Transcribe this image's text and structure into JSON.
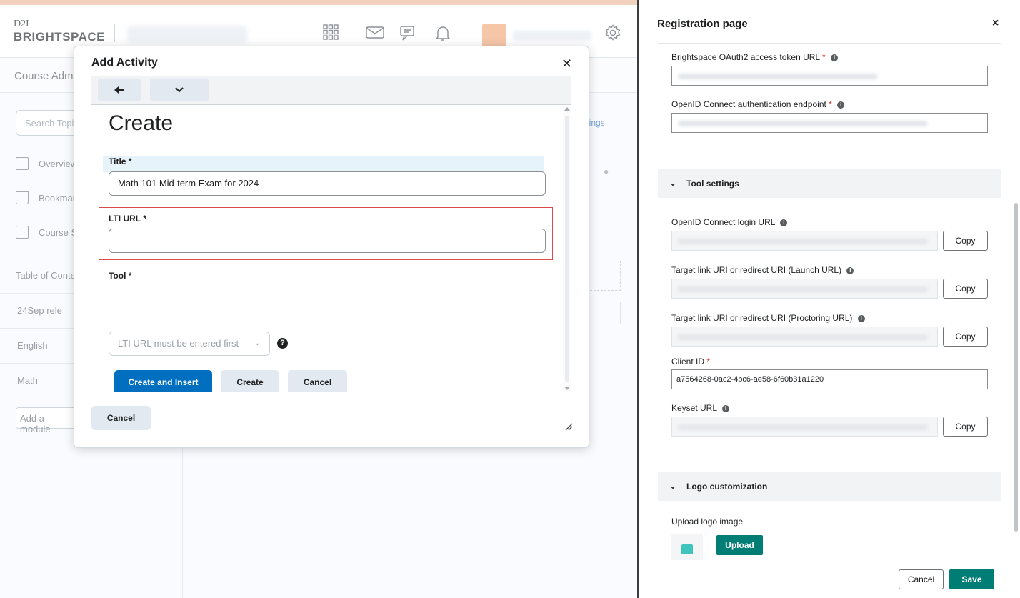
{
  "brightspace": {
    "logo_top": "D2L",
    "logo_bottom": "BRIGHTSPACE",
    "subnav_label": "Course Adm",
    "search_placeholder": "Search Topi",
    "sidebar_items": [
      {
        "label": "Overview",
        "icon": "presentation-icon"
      },
      {
        "label": "Bookmar",
        "icon": "bookmark-icon"
      },
      {
        "label": "Course S",
        "icon": "calendar-icon"
      }
    ],
    "toc_label": "Table of Conte",
    "modules": [
      "24Sep rele",
      "English",
      "Math"
    ],
    "add_module": "Add a module",
    "settings_link": "ttings"
  },
  "dialog": {
    "title": "Add Activity",
    "close_symbol": "✕",
    "back_symbol": "🡐",
    "menu_symbol": "⌄",
    "heading": "Create",
    "title_label": "Title *",
    "title_value": "Math 101 Mid-term Exam for 2024",
    "lti_url_label": "LTI URL *",
    "lti_url_value": "",
    "tool_label": "Tool *",
    "tool_select_value": "LTI URL must be entered first",
    "help_symbol": "?",
    "buttons": {
      "create_insert": "Create and Insert",
      "create": "Create",
      "cancel": "Cancel"
    },
    "footer_cancel": "Cancel"
  },
  "panel": {
    "title": "Registration page",
    "close_symbol": "×",
    "fields_top": [
      {
        "label": "Brightspace OAuth2 access token URL",
        "required": "*"
      },
      {
        "label": "OpenID Connect authentication endpoint",
        "required": "*"
      }
    ],
    "tool_settings": {
      "section_label": "Tool settings",
      "chevron": "⌄",
      "openid_login_label": "OpenID Connect login URL",
      "launch_url_label": "Target link URI or redirect URI (Launch URL)",
      "proctoring_url_label": "Target link URI or redirect URI (Proctoring URL)",
      "client_id_label": "Client ID",
      "client_id_required": "*",
      "client_id_value": "a7564268-0ac2-4bc6-ae58-6f60b31a1220",
      "keyset_label": "Keyset URL",
      "copy_label": "Copy"
    },
    "logo_customization": {
      "section_label": "Logo customization",
      "upload_label": "Upload logo image",
      "upload_button": "Upload"
    },
    "footer": {
      "cancel": "Cancel",
      "save": "Save"
    },
    "colors": {
      "accent_teal": "#007d74",
      "primary_blue": "#006fbf",
      "highlight_red": "#d94a4a"
    }
  }
}
